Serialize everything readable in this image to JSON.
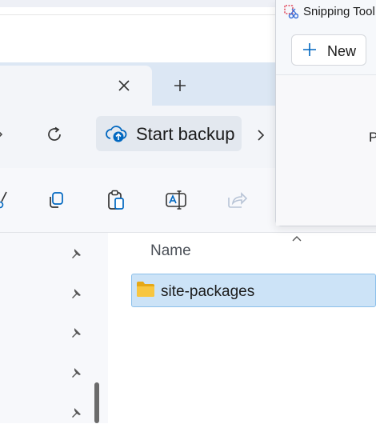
{
  "tab": {
    "close_symbol": "✕",
    "new_tab_symbol": "+"
  },
  "toolbar": {
    "backup_label": "Start backup",
    "refresh_symbol": "⟳",
    "more_symbol": "›"
  },
  "file_list": {
    "column_name": "Name",
    "selected_item": "site-packages"
  },
  "snipping_tool": {
    "title": "Snipping Tool",
    "new_label": "New",
    "new_symbol": "+",
    "partial_text": "P"
  },
  "colors": {
    "selection_bg": "#cce3f7",
    "selection_border": "#8cc0ea",
    "accent": "#0067c0"
  }
}
